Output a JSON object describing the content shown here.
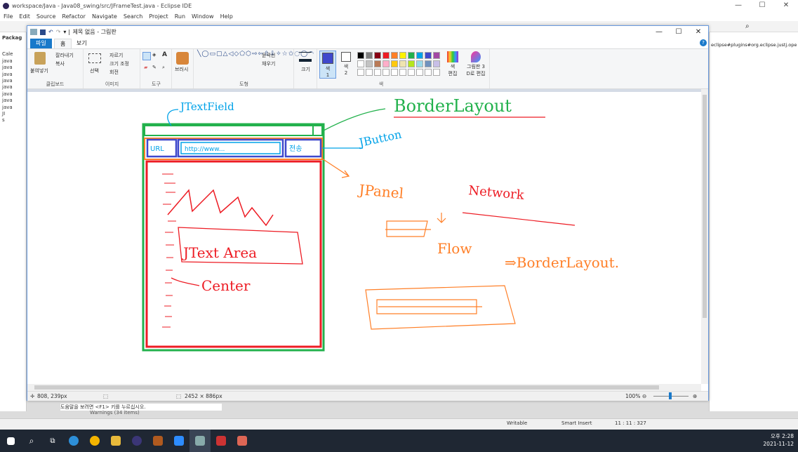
{
  "eclipse": {
    "title": "workspace/Java - Java08_swing/src/JFrameTest.java - Eclipse IDE",
    "menu": [
      "File",
      "Edit",
      "Source",
      "Refactor",
      "Navigate",
      "Search",
      "Project",
      "Run",
      "Window",
      "Help"
    ],
    "package_explorer_label": "Packag",
    "tree_items": [
      "Cale",
      "java",
      "java",
      "java",
      "java",
      "java",
      "java",
      "java",
      "java",
      "JI",
      "s"
    ],
    "right_url": "eclipse#plugins#org.eclipse.justj.ope",
    "warnings": "Warnings (34 items)",
    "status": {
      "writable": "Writable",
      "insert": "Smart Insert",
      "position": "11 : 11 : 327"
    }
  },
  "paint": {
    "title": "제목 없음 - 그림판",
    "tabs": {
      "file": "파일",
      "home": "홈",
      "view": "보기"
    },
    "clipboard": {
      "paste": "붙여넣기",
      "cut": "잘라내기",
      "copy": "복사",
      "group": "클립보드"
    },
    "image": {
      "select": "선택",
      "crop": "자르기",
      "resize": "크기 조정",
      "rotate": "회전",
      "group": "이미지"
    },
    "tools": {
      "group": "도구",
      "brush": "브러시"
    },
    "shapes": {
      "outline": "윤곽선",
      "fill": "채우기",
      "group": "도형"
    },
    "size": "크기",
    "color1": {
      "label": "색",
      "num": "1"
    },
    "color2": {
      "label": "색",
      "num": "2"
    },
    "edit_colors": {
      "line1": "색",
      "line2": "편집"
    },
    "paint3d": {
      "line1": "그림판 3",
      "line2": "D로 편집"
    },
    "colors_group": "색",
    "palette_row1": [
      "#000000",
      "#7f7f7f",
      "#880015",
      "#ed1c24",
      "#ff7f27",
      "#fff200",
      "#22b14c",
      "#00a2e8",
      "#3f48cc",
      "#a349a4"
    ],
    "palette_row2": [
      "#ffffff",
      "#c3c3c3",
      "#b97a57",
      "#ffaec9",
      "#ffc90e",
      "#efe4b0",
      "#b5e61d",
      "#99d9ea",
      "#7092be",
      "#c8bfe7"
    ],
    "status": {
      "cursor": "808, 239px",
      "size": "2452 × 886px",
      "zoom": "100%"
    },
    "help_tip": "도움말을 보려면 <F1> 키를 누르십시오."
  },
  "drawing": {
    "jtextfield": "JTextField",
    "borderlayout1": "BorderLayout",
    "jbutton": "JButton",
    "url_label": "URL",
    "url_value": "http://www...",
    "go_button": "전송",
    "jpanel": "JPanel",
    "network": "Network",
    "flow": "Flow",
    "borderlayout2": "⇒BorderLayout.",
    "jtextarea": "JText Area",
    "center": "Center"
  },
  "taskbar": {
    "time": "오후 2:28",
    "date": "2021-11-12"
  }
}
